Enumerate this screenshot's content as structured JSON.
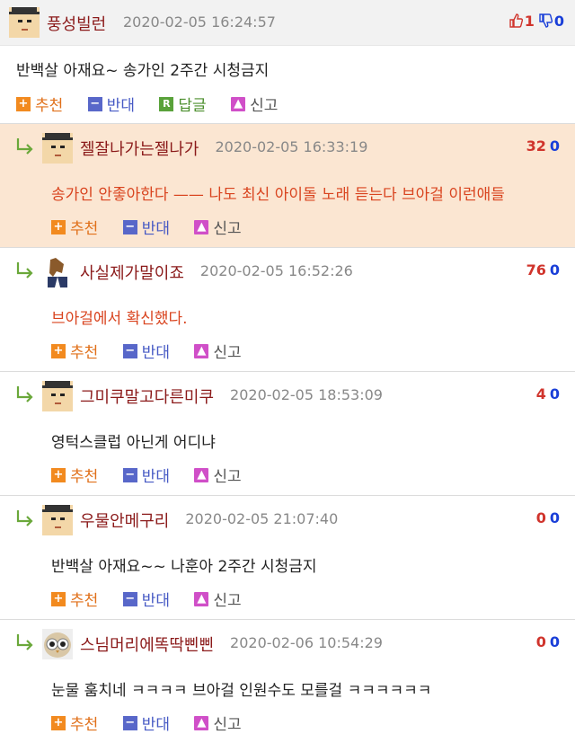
{
  "top_comment": {
    "nickname": "풍성빌런",
    "date": "2020-02-05 16:24:57",
    "up": "1",
    "down": "0",
    "text": "반백살 아재요~ 송가인 2주간 시청금지",
    "actions": {
      "recommend": "추천",
      "oppose": "반대",
      "reply_icon": "R",
      "reply": "답글",
      "report": "신고"
    }
  },
  "replies": [
    {
      "nickname": "젤잘나가는젤나가",
      "date": "2020-02-05 16:33:19",
      "up": "32",
      "down": "0",
      "text": "송가인 안좋아한다 —— 나도 최신 아이돌 노래 듣는다 브아걸 이런애들",
      "highlighted": true,
      "avatar": "hat"
    },
    {
      "nickname": "사실제가말이죠",
      "date": "2020-02-05 16:52:26",
      "up": "76",
      "down": "0",
      "text": "브아걸에서 확신했다.",
      "highlighted": false,
      "avatar": "horse"
    },
    {
      "nickname": "그미쿠말고다른미쿠",
      "date": "2020-02-05 18:53:09",
      "up": "4",
      "down": "0",
      "text": "영턱스클럽 아닌게 어디냐",
      "highlighted": false,
      "avatar": "hat"
    },
    {
      "nickname": "우물안메구리",
      "date": "2020-02-05 21:07:40",
      "up": "0",
      "down": "0",
      "text": "반백살 아재요~~ 나훈아 2주간 시청금지",
      "highlighted": false,
      "avatar": "hat"
    },
    {
      "nickname": "스님머리에똑딱삔삔",
      "date": "2020-02-06 10:54:29",
      "up": "0",
      "down": "0",
      "text": "눈물 훔치네 ㅋㅋㅋㅋ 브아걸 인원수도 모를걸 ㅋㅋㅋㅋㅋㅋ",
      "highlighted": false,
      "avatar": "owl"
    }
  ],
  "reply_actions": {
    "recommend": "추천",
    "oppose": "반대",
    "report": "신고"
  },
  "colors": {
    "nickname": "#8b1a1a",
    "up": "#d0342c",
    "down": "#1a3fd8",
    "highlight_bg": "#fbe6d2"
  }
}
